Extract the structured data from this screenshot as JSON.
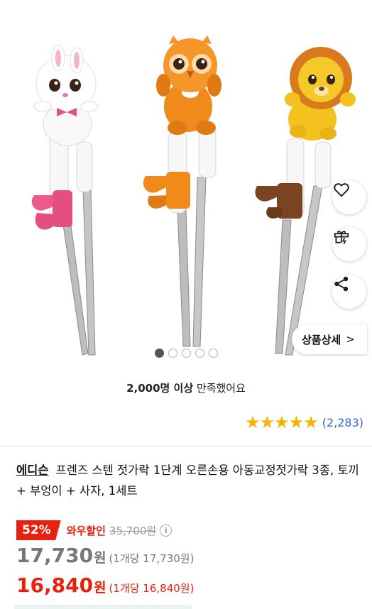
{
  "image": {
    "alt": "프렌즈 스텐 젓가락 - 토끼, 부엉이, 사자",
    "total_images": 5,
    "current_image": 1
  },
  "actions": {
    "wishlist_icon": "heart-icon",
    "gift_icon": "gift-icon",
    "share_icon": "share-icon",
    "detail_label": "상품상세",
    "detail_chevron": ">"
  },
  "satisfaction": {
    "count_text": "2,000명 이상",
    "suffix_text": " 만족했어요"
  },
  "rating": {
    "stars": 5,
    "star_glyph": "★",
    "review_count": "(2,283)"
  },
  "product": {
    "brand": "에디슨",
    "title": "프렌즈 스텐 젓가락 1단계 오른손용 아동교정젓가락 3종, 토끼 + 부엉이 + 사자, 1세트"
  },
  "pricing": {
    "discount_badge": "52%",
    "wow_label": "와우할인",
    "original_price": "35,700원",
    "info_icon_glyph": "i",
    "regular_price_num": "17,730",
    "regular_price_won": "원",
    "regular_unit": "(1개당 17,730원)",
    "wow_price_num": "16,840",
    "wow_price_won": "원",
    "wow_unit": "(1개당 16,840원)"
  },
  "colors": {
    "accent_red": "#e8200e",
    "star_yellow": "#f5b400",
    "link_blue": "#3468c9"
  }
}
